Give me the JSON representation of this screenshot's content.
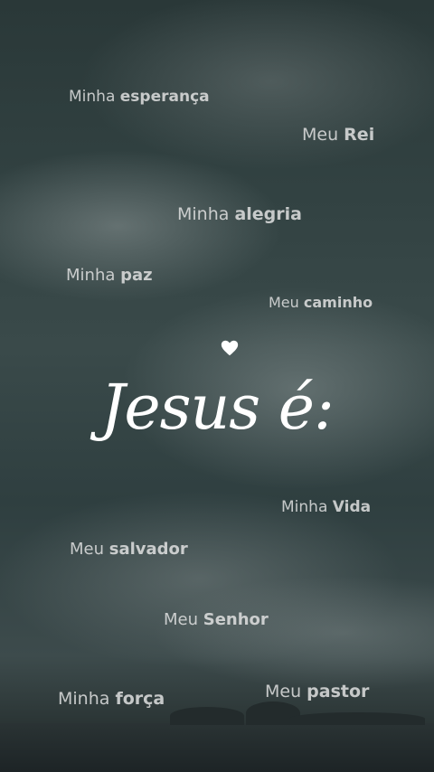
{
  "title": "Jesus é:",
  "phrases": [
    {
      "pre": "Minha",
      "bold": "esperança"
    },
    {
      "pre": "Meu",
      "bold": "Rei"
    },
    {
      "pre": "Minha",
      "bold": "alegria"
    },
    {
      "pre": "Minha",
      "bold": "paz"
    },
    {
      "pre": "Meu",
      "bold": "caminho"
    },
    {
      "pre": "Minha",
      "bold": "Vida"
    },
    {
      "pre": "Meu",
      "bold": "salvador"
    },
    {
      "pre": "Meu",
      "bold": "Senhor"
    },
    {
      "pre": "Meu",
      "bold": "pastor"
    },
    {
      "pre": "Minha",
      "bold": "força"
    }
  ]
}
